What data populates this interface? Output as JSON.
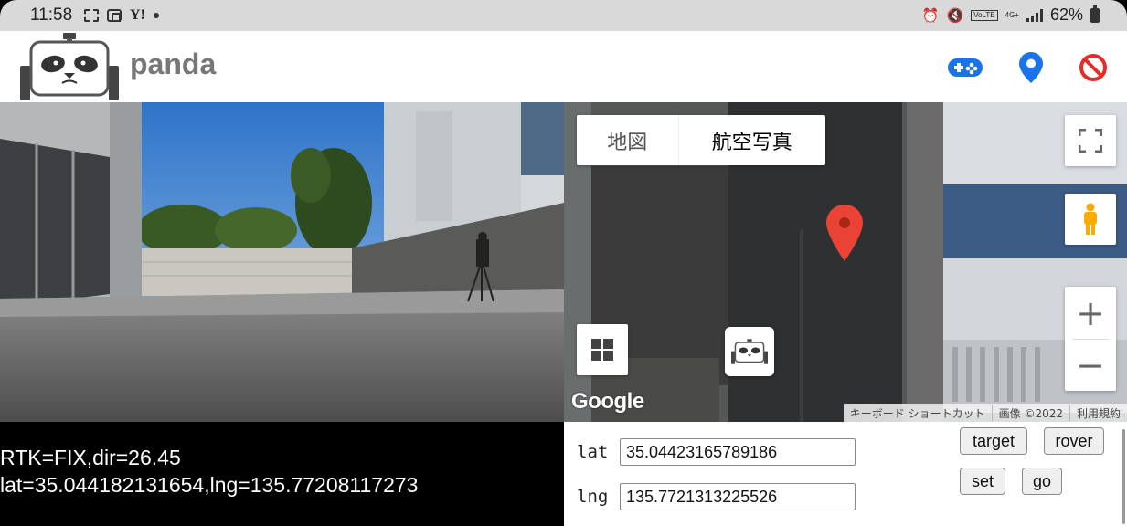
{
  "status_bar": {
    "time": "11:58",
    "left_icons": [
      "screenshot-icon",
      "screen-record-icon",
      "yahoo-icon",
      "notification-dot-icon"
    ],
    "right_icons": [
      "alarm-icon",
      "mute-icon",
      "volte-icon",
      "4g-icon",
      "signal-icon"
    ],
    "volte": "VoLTE",
    "network": "4G+",
    "battery": "62%"
  },
  "header": {
    "app_name": "panda",
    "buttons": [
      "gamepad-icon",
      "location-pin-icon",
      "stop-icon"
    ],
    "accent_color": "#1a73e8",
    "stop_color": "#e52d27"
  },
  "telemetry": {
    "line1": "RTK=FIX,dir=26.45",
    "line2": "lat=35.044182131654,lng=135.77208117273"
  },
  "map": {
    "type_map": "地図",
    "type_satellite": "航空写真",
    "zoom_in": "+",
    "zoom_out": "−",
    "logo": "Google",
    "attribution": [
      "キーボード ショートカット",
      "画像 ©2022",
      "利用規約"
    ],
    "marker_color": "#ea4335"
  },
  "form": {
    "lat_label": "lat",
    "lat_value": "35.04423165789186",
    "lng_label": "lng",
    "lng_value": "135.7721313225526",
    "btn_target": "target",
    "btn_rover": "rover",
    "btn_set": "set",
    "btn_go": "go"
  }
}
